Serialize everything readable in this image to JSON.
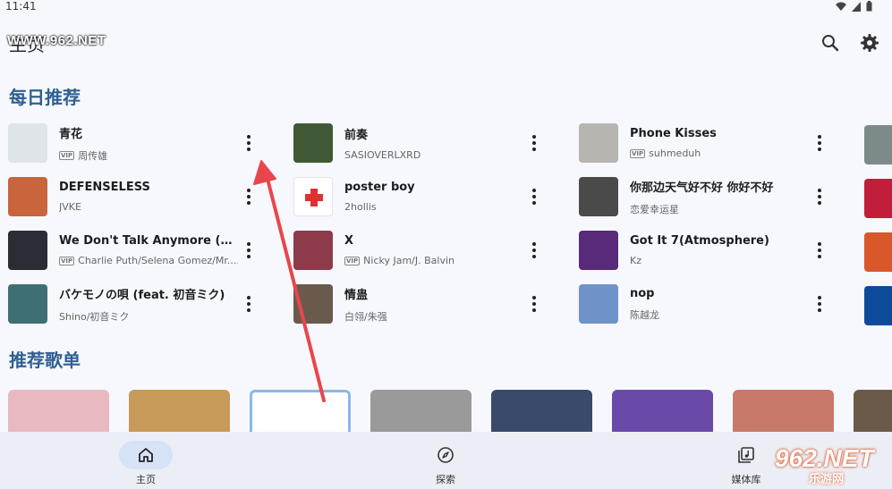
{
  "status_bar": {
    "time": "11:41"
  },
  "app_bar": {
    "title": "主页",
    "watermark": "WWW.962.NET"
  },
  "daily_section": {
    "title": "每日推荐"
  },
  "songs": [
    {
      "name": "青花",
      "artist": "周传雄",
      "vip": true,
      "cover": "#dfe4e8"
    },
    {
      "name": "DEFENSELESS",
      "artist": "JVKE",
      "vip": false,
      "cover": "#c9653d"
    },
    {
      "name": "We Don't Talk Anymore (Mr. ...",
      "artist": "Charlie Puth/Selena Gomez/Mr....",
      "vip": true,
      "cover": "#2a2d34"
    },
    {
      "name": "バケモノの唄 (feat. 初音ミク)",
      "artist": "Shino/初音ミク",
      "vip": false,
      "cover": "#3e6f74"
    },
    {
      "name": "前奏",
      "artist": "SASIOVERLXRD",
      "vip": false,
      "cover": "#3f5a34"
    },
    {
      "name": "poster boy",
      "artist": "2hollis",
      "vip": false,
      "cover": "#ffffff"
    },
    {
      "name": "X",
      "artist": "Nicky Jam/J. Balvin",
      "vip": true,
      "cover": "#8d3b4a"
    },
    {
      "name": "情蛊",
      "artist": "白翎/朱强",
      "vip": false,
      "cover": "#6a5a4e"
    },
    {
      "name": "Phone Kisses",
      "artist": "suhmeduh",
      "vip": true,
      "cover": "#b7b5b0"
    },
    {
      "name": "你那边天气好不好 你好不好",
      "artist": "恋爱幸运星",
      "vip": false,
      "cover": "#4a4a4a"
    },
    {
      "name": "Got It 7(Atmosphere)",
      "artist": "Kz",
      "vip": false,
      "cover": "#5a2a7a"
    },
    {
      "name": "nop",
      "artist": "陈越龙",
      "vip": false,
      "cover": "#6f93c8"
    }
  ],
  "peek_covers": [
    "#7c8a8a",
    "#c21e3a",
    "#d8582a",
    "#0e4a9a"
  ],
  "playlist_section": {
    "title": "推荐歌单"
  },
  "playlists": [
    "#e8b9c0",
    "#c89a5a",
    "#ffffff",
    "#9a9a9a",
    "#3a4a6a",
    "#6a4aa8",
    "#c87a6a",
    "#6a5a4a"
  ],
  "nav": {
    "home": "主页",
    "explore": "探索",
    "library": "媒体库"
  },
  "watermark_br": {
    "num": "962.NET",
    "sub": "乐游网"
  },
  "colors": {
    "accent": "#2f5f93",
    "nav_active": "#d6e3f7",
    "arrow": "#e8464c"
  }
}
